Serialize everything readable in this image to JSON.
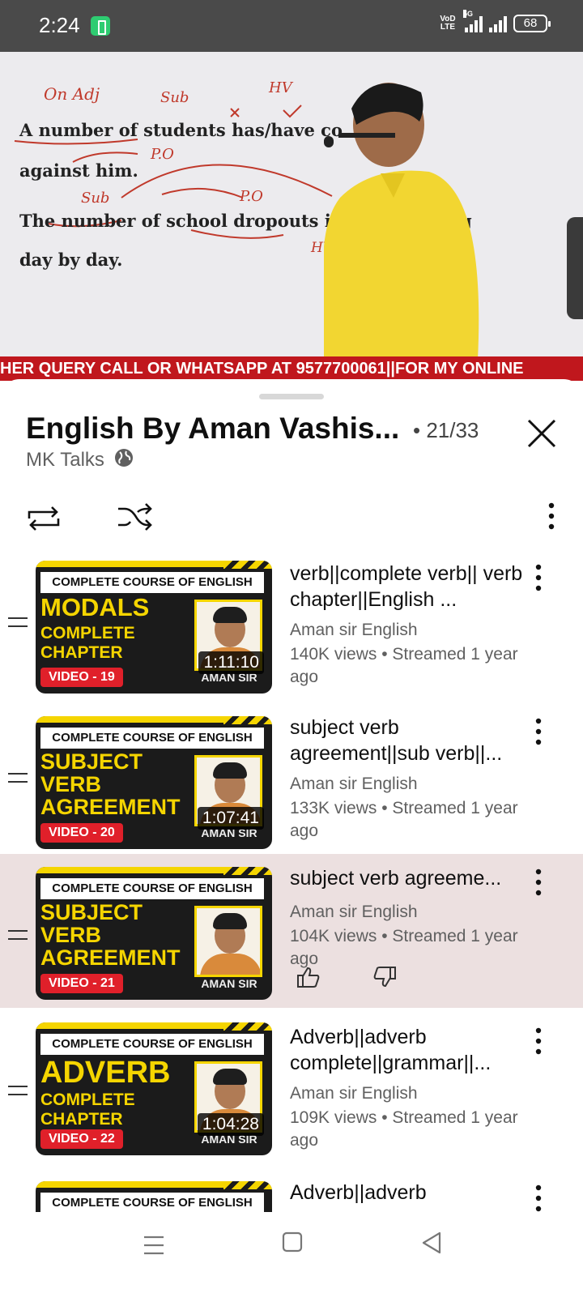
{
  "status": {
    "time": "2:24",
    "network_labels": [
      "VoD",
      "LTE",
      "5G"
    ],
    "battery": "68"
  },
  "video": {
    "board": {
      "handwriting_top_1": "On Adj",
      "handwriting_top_2": "Sub",
      "handwriting_top_3": "HV",
      "line1": "A number of students has/have co",
      "line2": "against him.",
      "handwriting_mid_1": "P.O",
      "handwriting_mid_2": "Sub",
      "handwriting_mid_3": "P.O",
      "line3": "The number of school dropouts is /ar",
      "line3_tail": "g",
      "line4": "day by day.",
      "handwriting_bottom": "HV"
    },
    "ticker": "HER QUERY CALL OR WHATSAPP AT 9577700061||FOR MY ONLINE"
  },
  "playlist": {
    "title": "English By Aman Vashis...",
    "position": "• 21/33",
    "channel": "MK Talks",
    "items": [
      {
        "thumb_header": "COMPLETE COURSE OF ENGLISH",
        "thumb_line1": "MODALS",
        "thumb_line2": "COMPLETE",
        "thumb_line3": "CHAPTER",
        "thumb_video": "VIDEO - 19",
        "thumb_brand": "AMAN SIR",
        "duration": "1:11:10",
        "title": "verb||complete verb|| verb chapter||English ...",
        "channel": "Aman sir English",
        "meta": "140K views • Streamed 1 year ago"
      },
      {
        "thumb_header": "COMPLETE COURSE OF ENGLISH",
        "thumb_line1": "SUBJECT",
        "thumb_line2": "VERB",
        "thumb_line3": "AGREEMENT",
        "thumb_video": "VIDEO - 20",
        "thumb_brand": "AMAN SIR",
        "duration": "1:07:41",
        "title": "subject verb agreement||sub verb||...",
        "channel": "Aman sir English",
        "meta": "133K views • Streamed 1 year ago"
      },
      {
        "thumb_header": "COMPLETE COURSE OF ENGLISH",
        "thumb_line1": "SUBJECT",
        "thumb_line2": "VERB",
        "thumb_line3": "AGREEMENT",
        "thumb_video": "VIDEO - 21",
        "thumb_brand": "AMAN SIR",
        "title": "subject verb agreeme...",
        "channel": "Aman sir English",
        "meta": "104K views • Streamed 1 year ago"
      },
      {
        "thumb_header": "COMPLETE COURSE OF ENGLISH",
        "thumb_line1": "ADVERB",
        "thumb_line2": "COMPLETE",
        "thumb_line3": "CHAPTER",
        "thumb_video": "VIDEO - 22",
        "thumb_brand": "AMAN SIR",
        "duration": "1:04:28",
        "title": "Adverb||adverb complete||grammar||...",
        "channel": "Aman sir English",
        "meta": "109K views • Streamed 1 year ago"
      },
      {
        "thumb_header": "COMPLETE COURSE OF ENGLISH",
        "title": "Adverb||adverb"
      }
    ]
  },
  "colors": {
    "ticker_red": "#c0171d",
    "thumb_yellow": "#f5d500",
    "active_row": "#ece0e0"
  }
}
